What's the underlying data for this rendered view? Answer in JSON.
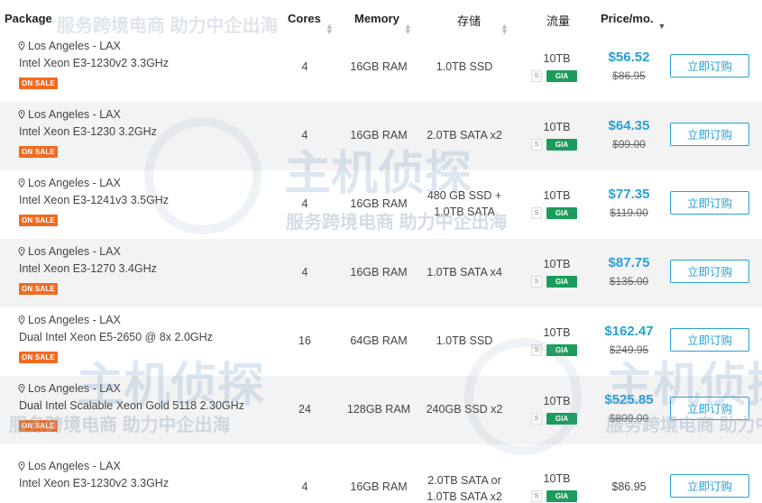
{
  "header": {
    "package": "Package",
    "cores": "Cores",
    "memory": "Memory",
    "storage": "存储",
    "traffic": "流量",
    "price": "Price/mo."
  },
  "icons": {
    "location": "map-pin-icon",
    "sort": "sort-icon",
    "sort_active": "sort-down-icon"
  },
  "colors": {
    "accent": "#2a9fd6",
    "sale_badge": "#f26a21",
    "gia_badge": "#1c9c5c",
    "row_alt": "#f3f3f3"
  },
  "watermark": {
    "brand": "主机侦探",
    "tagline": "服务跨境电商 助力中企出海"
  },
  "rows": [
    {
      "location": "Los Angeles - LAX",
      "cpu": "Intel Xeon E3-1230v2 3.3GHz",
      "badge": "ON SALE",
      "cores": "4",
      "memory": "16GB RAM",
      "storage_1": "1.0TB SSD",
      "storage_2": "",
      "traffic": "10TB",
      "s_tag": "S",
      "network": "GIA",
      "price": "$56.52",
      "old_price": "$86.95",
      "button": "立即订购"
    },
    {
      "location": "Los Angeles - LAX",
      "cpu": "Intel Xeon E3-1230 3.2GHz",
      "badge": "ON SALE",
      "cores": "4",
      "memory": "16GB RAM",
      "storage_1": "2.0TB SATA x2",
      "storage_2": "",
      "traffic": "10TB",
      "s_tag": "S",
      "network": "GIA",
      "price": "$64.35",
      "old_price": "$99.00",
      "button": "立即订购"
    },
    {
      "location": "Los Angeles - LAX",
      "cpu": "Intel Xeon E3-1241v3 3.5GHz",
      "badge": "ON SALE",
      "cores": "4",
      "memory": "16GB RAM",
      "storage_1": "480 GB SSD +",
      "storage_2": "1.0TB SATA",
      "traffic": "10TB",
      "s_tag": "S",
      "network": "GIA",
      "price": "$77.35",
      "old_price": "$119.00",
      "button": "立即订购"
    },
    {
      "location": "Los Angeles - LAX",
      "cpu": "Intel Xeon E3-1270 3.4GHz",
      "badge": "ON SALE",
      "cores": "4",
      "memory": "16GB RAM",
      "storage_1": "1.0TB SATA x4",
      "storage_2": "",
      "traffic": "10TB",
      "s_tag": "S",
      "network": "GIA",
      "price": "$87.75",
      "old_price": "$135.00",
      "button": "立即订购"
    },
    {
      "location": "Los Angeles - LAX",
      "cpu": "Dual Intel Xeon E5-2650 @ 8x 2.0GHz",
      "badge": "ON SALE",
      "cores": "16",
      "memory": "64GB RAM",
      "storage_1": "1.0TB SSD",
      "storage_2": "",
      "traffic": "10TB",
      "s_tag": "S",
      "network": "GIA",
      "price": "$162.47",
      "old_price": "$249.95",
      "button": "立即订购"
    },
    {
      "location": "Los Angeles - LAX",
      "cpu": "Dual Intel Scalable Xeon Gold 5118 2.30GHz",
      "badge": "ON SALE",
      "cores": "24",
      "memory": "128GB RAM",
      "storage_1": "240GB SSD x2",
      "storage_2": "",
      "traffic": "10TB",
      "s_tag": "S",
      "network": "GIA",
      "price": "$525.85",
      "old_price": "$809.00",
      "button": "立即订购"
    },
    {
      "location": "Los Angeles - LAX",
      "cpu": "Intel Xeon E3-1230v2 3.3GHz",
      "badge": "",
      "cores": "4",
      "memory": "16GB RAM",
      "storage_1": "2.0TB SATA or",
      "storage_2": "1.0TB SATA x2",
      "traffic": "10TB",
      "s_tag": "S",
      "network": "GIA",
      "price": "$86.95",
      "old_price": "",
      "button": "立即订购"
    }
  ]
}
